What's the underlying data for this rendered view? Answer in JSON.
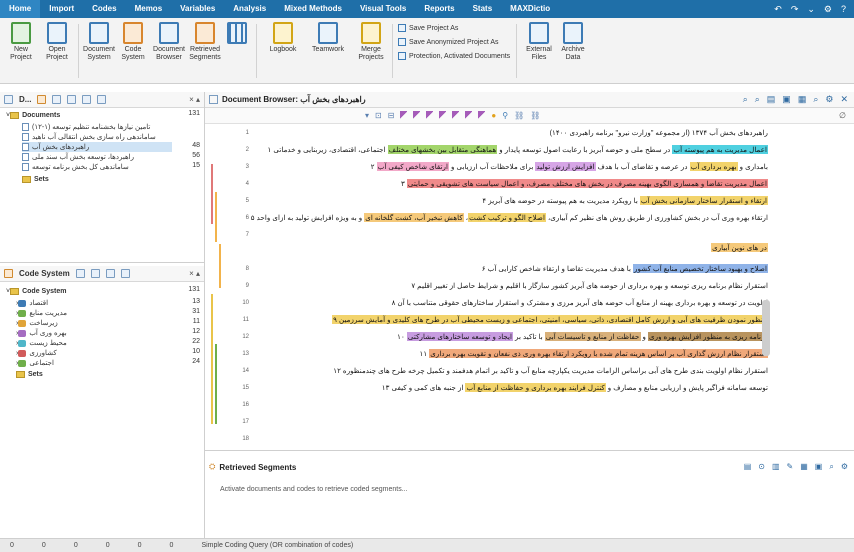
{
  "menu": {
    "items": [
      "Home",
      "Import",
      "Codes",
      "Memos",
      "Variables",
      "Analysis",
      "Mixed Methods",
      "Visual Tools",
      "Reports",
      "Stats",
      "MAXDictio"
    ],
    "right_icons": [
      "undo-icon",
      "redo-icon",
      "chevron-down-icon",
      "gear-icon",
      "help-icon"
    ]
  },
  "ribbon": {
    "new_project": "New Project",
    "open_project": "Open Project",
    "document_system": "Document System",
    "code_system": "Code System",
    "document_browser": "Document Browser",
    "retrieved_segments": "Retrieved Segments",
    "logbook": "Logbook",
    "teamwork": "Teamwork",
    "merge_projects": "Merge Projects",
    "save_project_as": "Save Project As",
    "save_anonymized": "Save Anonymized Project As",
    "protection": "Protection, Activated Documents",
    "external_files": "External Files",
    "archive_data": "Archive Data"
  },
  "document_system": {
    "title": "D...",
    "root": "Documents",
    "root_count": "131",
    "items": [
      {
        "label": "تامین نیازها بخشنامه تنظیم توسعه (۱-۱۲)",
        "count": ""
      },
      {
        "label": "ساماندهی راه سازی بخش انتقالی آب ناهید",
        "count": ""
      },
      {
        "label": "راهبردهای بخش آب",
        "count": "48"
      },
      {
        "label": "راهبردها، توسعه بخش آب سند ملی",
        "count": "56"
      },
      {
        "label": "ساماندهی کل بخش برنامه توسعه",
        "count": "15"
      }
    ],
    "sets": "Sets"
  },
  "code_system": {
    "title": "Code System",
    "root": "Code System",
    "root_count": "131",
    "items": [
      {
        "label": "اقتصاد",
        "count": "13",
        "color": "#3d7bb5"
      },
      {
        "label": "مدیریت منابع",
        "count": "31",
        "color": "#6fae4a"
      },
      {
        "label": "زیرساخت",
        "count": "11",
        "color": "#e0a438"
      },
      {
        "label": "بهره وری آب",
        "count": "12",
        "color": "#a56cc1"
      },
      {
        "label": "محیط زیست",
        "count": "22",
        "color": "#4fb6c9"
      },
      {
        "label": "کشاورزی",
        "count": "10",
        "color": "#d15b5b"
      },
      {
        "label": "اجتماعی",
        "count": "24",
        "color": "#6fae4a"
      }
    ],
    "sets": "Sets"
  },
  "document_browser": {
    "title": "Document Browser: راهبردهای بخش آب",
    "line_numbers": [
      "1",
      "2",
      "3",
      "4",
      "5",
      "6",
      "7",
      "",
      "8",
      "9",
      "10",
      "11",
      "12",
      "13",
      "14",
      "15",
      "16",
      "17",
      "18"
    ],
    "paragraphs": [
      {
        "parts": [
          {
            "t": "راهبردهای بخش آب ۱۳۷۴ (از مجموعه \"وزارت نیرو\" برنامه راهبردی ۱۴۰۰)",
            "c": ""
          }
        ]
      },
      {
        "parts": [
          {
            "t": "اعمال مدیریت به هم پیوسته آب",
            "c": "#4fd0e0"
          },
          {
            "t": " در سطح ملی و حوضه آبریز با رعایت اصول توسعه پایدار و ",
            "c": ""
          },
          {
            "t": "هماهنگی متقابل بین بخشهای مختلف",
            "c": "#a3d56b"
          },
          {
            "t": " اجتماعی، اقتصادی، زیربنایی و خدماتی ۱",
            "c": ""
          }
        ]
      },
      {
        "parts": [
          {
            "t": "بامداری و ",
            "c": ""
          },
          {
            "t": "بهره برداری آب",
            "c": "#f2d36b"
          },
          {
            "t": " در عرصه و تقاضای آب با هدف ",
            "c": ""
          },
          {
            "t": "افزایش ارزش تولید",
            "c": "#d6a5e6"
          },
          {
            "t": " برای ملاحظات آب ارزیابی و ",
            "c": ""
          },
          {
            "t": "ارتقای شاخص کیفی آب",
            "c": "#f2a8c8"
          },
          {
            "t": " ۲",
            "c": ""
          }
        ]
      },
      {
        "parts": [
          {
            "t": "اعمال مدیریت تقاضا و همسازی الگوی بهینه مصرف در بخش های مختلف مصرف، و اعمال سیاست های تشویقی و حمایتی",
            "c": "#f08a8a"
          },
          {
            "t": " ۳",
            "c": ""
          }
        ]
      },
      {
        "parts": [
          {
            "t": "ارتقاء و استقرار ساختار سازمانی بخش آب",
            "c": "#f2d36b"
          },
          {
            "t": " با رویکرد مدیریت به هم پیوسته در حوضه های آبریز ۴",
            "c": ""
          }
        ]
      },
      {
        "parts": [
          {
            "t": "ارتقاء بهره وری آب در بخش کشاورزی از طریق روش های نظیر کم آبیاری، ",
            "c": ""
          },
          {
            "t": "اصلاح الگو و ترکیب کشت",
            "c": "#f2d36b"
          },
          {
            "t": "، ",
            "c": ""
          },
          {
            "t": "کاهش تبخیر آب، کشت گلخانه ای",
            "c": "#f5c97a"
          },
          {
            "t": " و به ویژه افزایش تولید به ازای واحد ۵",
            "c": ""
          }
        ]
      },
      {
        "parts": [
          {
            "t": "در های نوین آبیاری",
            "c": "#f5c97a"
          }
        ]
      },
      {
        "parts": [
          {
            "t": "اصلاح و بهبود ساختار تخصیص منابع آب کشور",
            "c": "#8fb3e8"
          },
          {
            "t": " با هدف مدیریت تقاضا و ارتقاء شاخص کارایی آب ۶",
            "c": ""
          }
        ]
      },
      {
        "parts": [
          {
            "t": "استقرار نظام برنامه ریزی توسعه و بهره برداری از حوضه های آبریز کشور سازگار با اقلیم و شرایط حاصل از تغییر اقلیم ۷",
            "c": ""
          }
        ]
      },
      {
        "parts": [
          {
            "t": "اولویت در توسعه و بهره برداری بهینه از منابع آب حوضه های آبریز مرزی و مشترک و استقرار ساختارهای حقوقی متناسب با آن ۸",
            "c": ""
          }
        ]
      },
      {
        "parts": [
          {
            "t": "منظور نمودن ظرفیت های آبی و ارزش کامل اقتصادی، ذاتی، سیاسی، امنیتی، اجتماعی و زیست محیطی آب در طرح های کلیدی و آمایش سرزمین ۹",
            "c": "#f2d36b"
          }
        ]
      },
      {
        "parts": [
          {
            "t": "برنامه ریزی به منظور افزایش بهره وری",
            "c": "#b8935e"
          },
          {
            "t": " و ",
            "c": ""
          },
          {
            "t": "حفاظت از منابع و تاسیسات آبی",
            "c": "#d8b07a"
          },
          {
            "t": " با تاکید بر ",
            "c": ""
          },
          {
            "t": "ایجاد و توسعه ساختارهای مشارکتی",
            "c": "#c79ce0"
          },
          {
            "t": " ۱۰",
            "c": ""
          }
        ]
      },
      {
        "parts": [
          {
            "t": "استقرار نظام ارزش گذاری آب بر اساس هزینه تمام شده با رویکرد ارتقاء بهره وری ذی نفعان و تقویت بهره برداری",
            "c": "#f0a87a"
          },
          {
            "t": " ۱۱",
            "c": ""
          }
        ]
      },
      {
        "parts": [
          {
            "t": "استقرار نظام اولویت بندی طرح های آبی براساس الزامات مدیریت یکپارچه منابع آب و تاکید بر اتمام هدفمند و تکمیل چرخه طرح های چندمنظوره ۱۲",
            "c": ""
          }
        ]
      },
      {
        "parts": [
          {
            "t": "توسعه سامانه فراگیر پایش و ارزیابی منابع و مصارف و ",
            "c": ""
          },
          {
            "t": "کنترل فرایند بهره برداری و حفاظت از منابع آب",
            "c": "#f2d36b"
          },
          {
            "t": " از جنبه های کمی و کیفی ۱۳",
            "c": ""
          }
        ]
      }
    ]
  },
  "retrieved_segments": {
    "title": "Retrieved Segments",
    "message": "Activate documents and codes to retrieve coded segments..."
  },
  "status_bar": {
    "items": [
      "0",
      "0",
      "0",
      "0",
      "0",
      "0"
    ],
    "message": "Simple Coding Query (OR combination of codes)"
  },
  "colors": {
    "menubar": "#1f6fa8",
    "accent": "#3d7bb5"
  }
}
